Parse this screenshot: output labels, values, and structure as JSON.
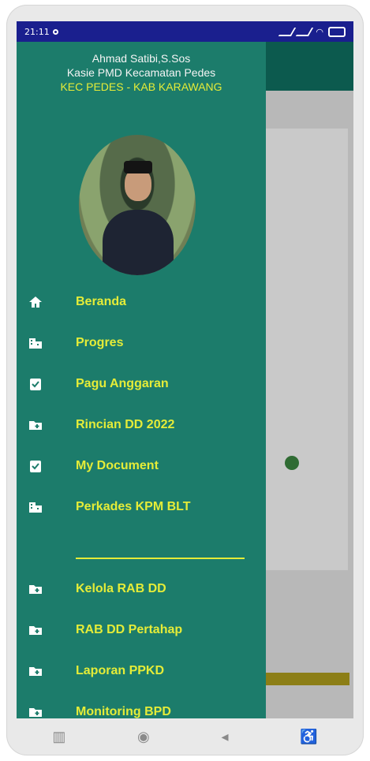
{
  "status_bar": {
    "time": "21:11"
  },
  "profile": {
    "name": "Ahmad Satibi,S.Sos",
    "role": "Kasie PMD Kecamatan Pedes",
    "area": "KEC PEDES - KAB KARAWANG"
  },
  "menu": {
    "primary": [
      {
        "label": "Beranda",
        "icon": "home-icon"
      },
      {
        "label": "Progres",
        "icon": "building-icon"
      },
      {
        "label": "Pagu Anggaran",
        "icon": "clipboard-check-icon"
      },
      {
        "label": "Rincian DD 2022",
        "icon": "folder-plus-icon"
      },
      {
        "label": "My Document",
        "icon": "clipboard-check-icon"
      },
      {
        "label": "Perkades KPM BLT",
        "icon": "building-icon"
      }
    ],
    "secondary": [
      {
        "label": "Kelola RAB DD",
        "icon": "folder-plus-icon"
      },
      {
        "label": "RAB DD Pertahap",
        "icon": "folder-plus-icon"
      },
      {
        "label": "Laporan PPKD",
        "icon": "folder-plus-icon"
      },
      {
        "label": "Monitoring BPD",
        "icon": "folder-plus-icon"
      }
    ]
  },
  "colors": {
    "drawer": "#1c7c6b",
    "accent_text": "#e5ec38",
    "status_bar": "#1a1f8e"
  },
  "nav_bar": {
    "recents": "▥",
    "home": "◉",
    "back": "◂",
    "accessibility": "♿"
  }
}
